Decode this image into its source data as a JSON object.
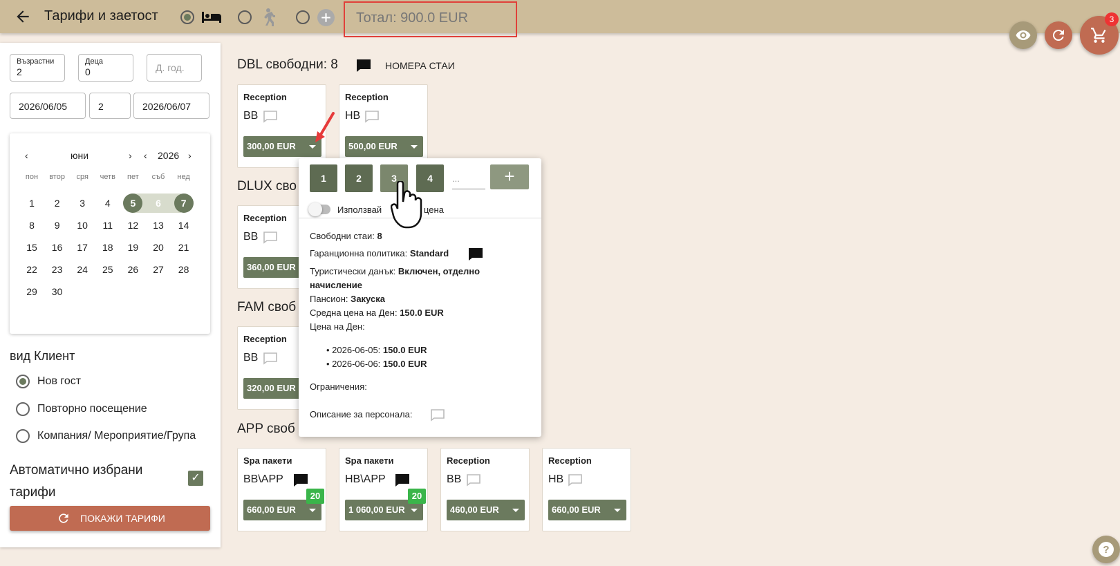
{
  "header": {
    "title": "Тарифи и заетост",
    "total": "Тотал: 900.0 EUR",
    "cart_count": "3"
  },
  "search": {
    "adults_label": "Възрастни",
    "adults_value": "2",
    "children_label": "Деца",
    "children_value": "0",
    "child_age_placeholder": "Д. год.",
    "date_from": "2026/06/05",
    "nights": "2",
    "date_to": "2026/06/07"
  },
  "calendar": {
    "month": "юни",
    "year": "2026",
    "weekdays": [
      "пон",
      "втор",
      "сря",
      "четв",
      "пет",
      "съб",
      "нед"
    ],
    "days": [
      "1",
      "2",
      "3",
      "4",
      "5",
      "6",
      "7",
      "8",
      "9",
      "10",
      "11",
      "12",
      "13",
      "14",
      "15",
      "16",
      "17",
      "18",
      "19",
      "20",
      "21",
      "22",
      "23",
      "24",
      "25",
      "26",
      "27",
      "28",
      "29",
      "30"
    ]
  },
  "client": {
    "heading": "вид Клиент",
    "options": [
      "Нов гост",
      "Повторно посещение",
      "Компания/ Мероприятие/Група"
    ],
    "auto_label_1": "Автоматично избрани",
    "auto_label_2": "тарифи",
    "show_button": "ПОКАЖИ ТАРИФИ"
  },
  "rooms": {
    "dbl_title": "DBL свободни: 8",
    "room_numbers_label": "НОМЕРА СТАИ",
    "dlux_title": "DLUX сво",
    "fam_title": "FAM своб",
    "app_title": "APP своб",
    "dbl_cards": [
      {
        "source": "Reception",
        "plan": "BB",
        "price": "300,00 EUR"
      },
      {
        "source": "Reception",
        "plan": "HB",
        "price": "500,00 EUR"
      }
    ],
    "dlux_cards": [
      {
        "source": "Reception",
        "plan": "BB",
        "price": "360,00 EUR"
      }
    ],
    "fam_cards": [
      {
        "source": "Reception",
        "plan": "BB",
        "price": "320,00 EUR"
      }
    ],
    "app_cards": [
      {
        "source": "Spa пакети",
        "plan": "BB\\APP",
        "price": "660,00 EUR",
        "badge": "20"
      },
      {
        "source": "Spa пакети",
        "plan": "HB\\APP",
        "price": "1 060,00 EUR",
        "badge": "20"
      },
      {
        "source": "Reception",
        "plan": "BB",
        "price": "460,00 EUR"
      },
      {
        "source": "Reception",
        "plan": "HB",
        "price": "660,00 EUR"
      }
    ]
  },
  "popup": {
    "qty_buttons": [
      "1",
      "2",
      "3",
      "4"
    ],
    "qty_placeholder": "...",
    "toggle_label_a": "Използвай",
    "toggle_label_b": "цена",
    "free_rooms_label": "Свободни стаи:",
    "free_rooms_value": "8",
    "guarantee_label": "Гаранционна политика:",
    "guarantee_value": "Standard",
    "tax_label": "Туристически данък:",
    "tax_value_1": "Включен, отделно",
    "tax_value_2": "начисление",
    "board_label": "Пансион:",
    "board_value": "Закуска",
    "avg_label": "Средна цена на Ден:",
    "avg_value": "150.0 EUR",
    "per_day_label": "Цена на Ден:",
    "per_day": [
      {
        "date": "2026-06-05:",
        "price": "150.0 EUR"
      },
      {
        "date": "2026-06-06:",
        "price": "150.0 EUR"
      }
    ],
    "restrictions_label": "Ограничения:",
    "staff_desc_label": "Описание за персонала:"
  },
  "colors": {
    "accent": "#6b7a5e",
    "topbar": "#cdbc9a",
    "primary_button": "#c06b52",
    "badge": "#3ab54a",
    "highlight": "#e0403a"
  }
}
